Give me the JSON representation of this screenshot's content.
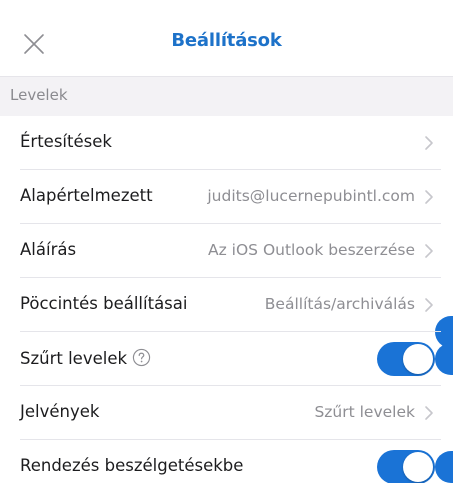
{
  "header": {
    "close_icon": "close-icon",
    "title": "Beállítások"
  },
  "section": {
    "title": "Levelek"
  },
  "rows": [
    {
      "label": "Értesítések",
      "value": "",
      "control": "chevron"
    },
    {
      "label": "Alapértelmezett",
      "value": "judits@lucernepubintl.com",
      "control": "chevron"
    },
    {
      "label": "Aláírás",
      "value": "Az iOS Outlook beszerzése",
      "control": "chevron"
    },
    {
      "label": "Pöccintés beállításai",
      "value": "Beállítás/archiválás",
      "control": "chevron"
    },
    {
      "label": "Szűrt levelek",
      "value": "",
      "control": "toggle",
      "on": true,
      "help_icon": "help-icon"
    },
    {
      "label": "Jelvények",
      "value": "Szűrt levelek",
      "control": "chevron"
    },
    {
      "label": "Rendezés beszélgetésekbe",
      "value": "",
      "control": "toggle",
      "on": true
    }
  ],
  "colors": {
    "accent": "#1d72c9",
    "toggle_on": "#1a73d6",
    "section_bg": "#f3f2f5",
    "secondary_text": "#8e8e93"
  }
}
